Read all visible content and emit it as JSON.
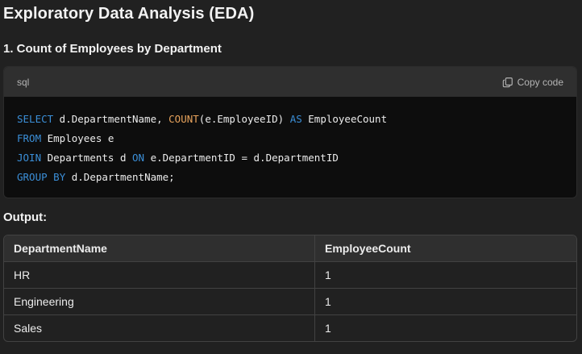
{
  "page": {
    "title": "Exploratory Data Analysis (EDA)",
    "section_title": "1. Count of Employees by Department",
    "output_label": "Output:"
  },
  "code": {
    "language": "sql",
    "copy_label": "Copy code",
    "lines": [
      [
        {
          "t": "SELECT",
          "c": "kw"
        },
        {
          "t": " d.DepartmentName, ",
          "c": ""
        },
        {
          "t": "COUNT",
          "c": "fn"
        },
        {
          "t": "(e.EmployeeID) ",
          "c": ""
        },
        {
          "t": "AS",
          "c": "kw"
        },
        {
          "t": " EmployeeCount",
          "c": ""
        }
      ],
      [
        {
          "t": "FROM",
          "c": "kw"
        },
        {
          "t": " Employees e",
          "c": ""
        }
      ],
      [
        {
          "t": "JOIN",
          "c": "kw"
        },
        {
          "t": " Departments d ",
          "c": ""
        },
        {
          "t": "ON",
          "c": "kw"
        },
        {
          "t": " e.DepartmentID = d.DepartmentID",
          "c": ""
        }
      ],
      [
        {
          "t": "GROUP",
          "c": "kw"
        },
        {
          "t": " ",
          "c": ""
        },
        {
          "t": "BY",
          "c": "kw"
        },
        {
          "t": " d.DepartmentName;",
          "c": ""
        }
      ]
    ]
  },
  "table": {
    "columns": [
      "DepartmentName",
      "EmployeeCount"
    ],
    "rows": [
      [
        "HR",
        "1"
      ],
      [
        "Engineering",
        "1"
      ],
      [
        "Sales",
        "1"
      ]
    ]
  },
  "colors": {
    "keyword": "#3b8fd8",
    "function": "#e8a35c",
    "background": "#212121",
    "code_background": "#0d0d0d"
  },
  "icons": {
    "copy": "copy-icon"
  }
}
